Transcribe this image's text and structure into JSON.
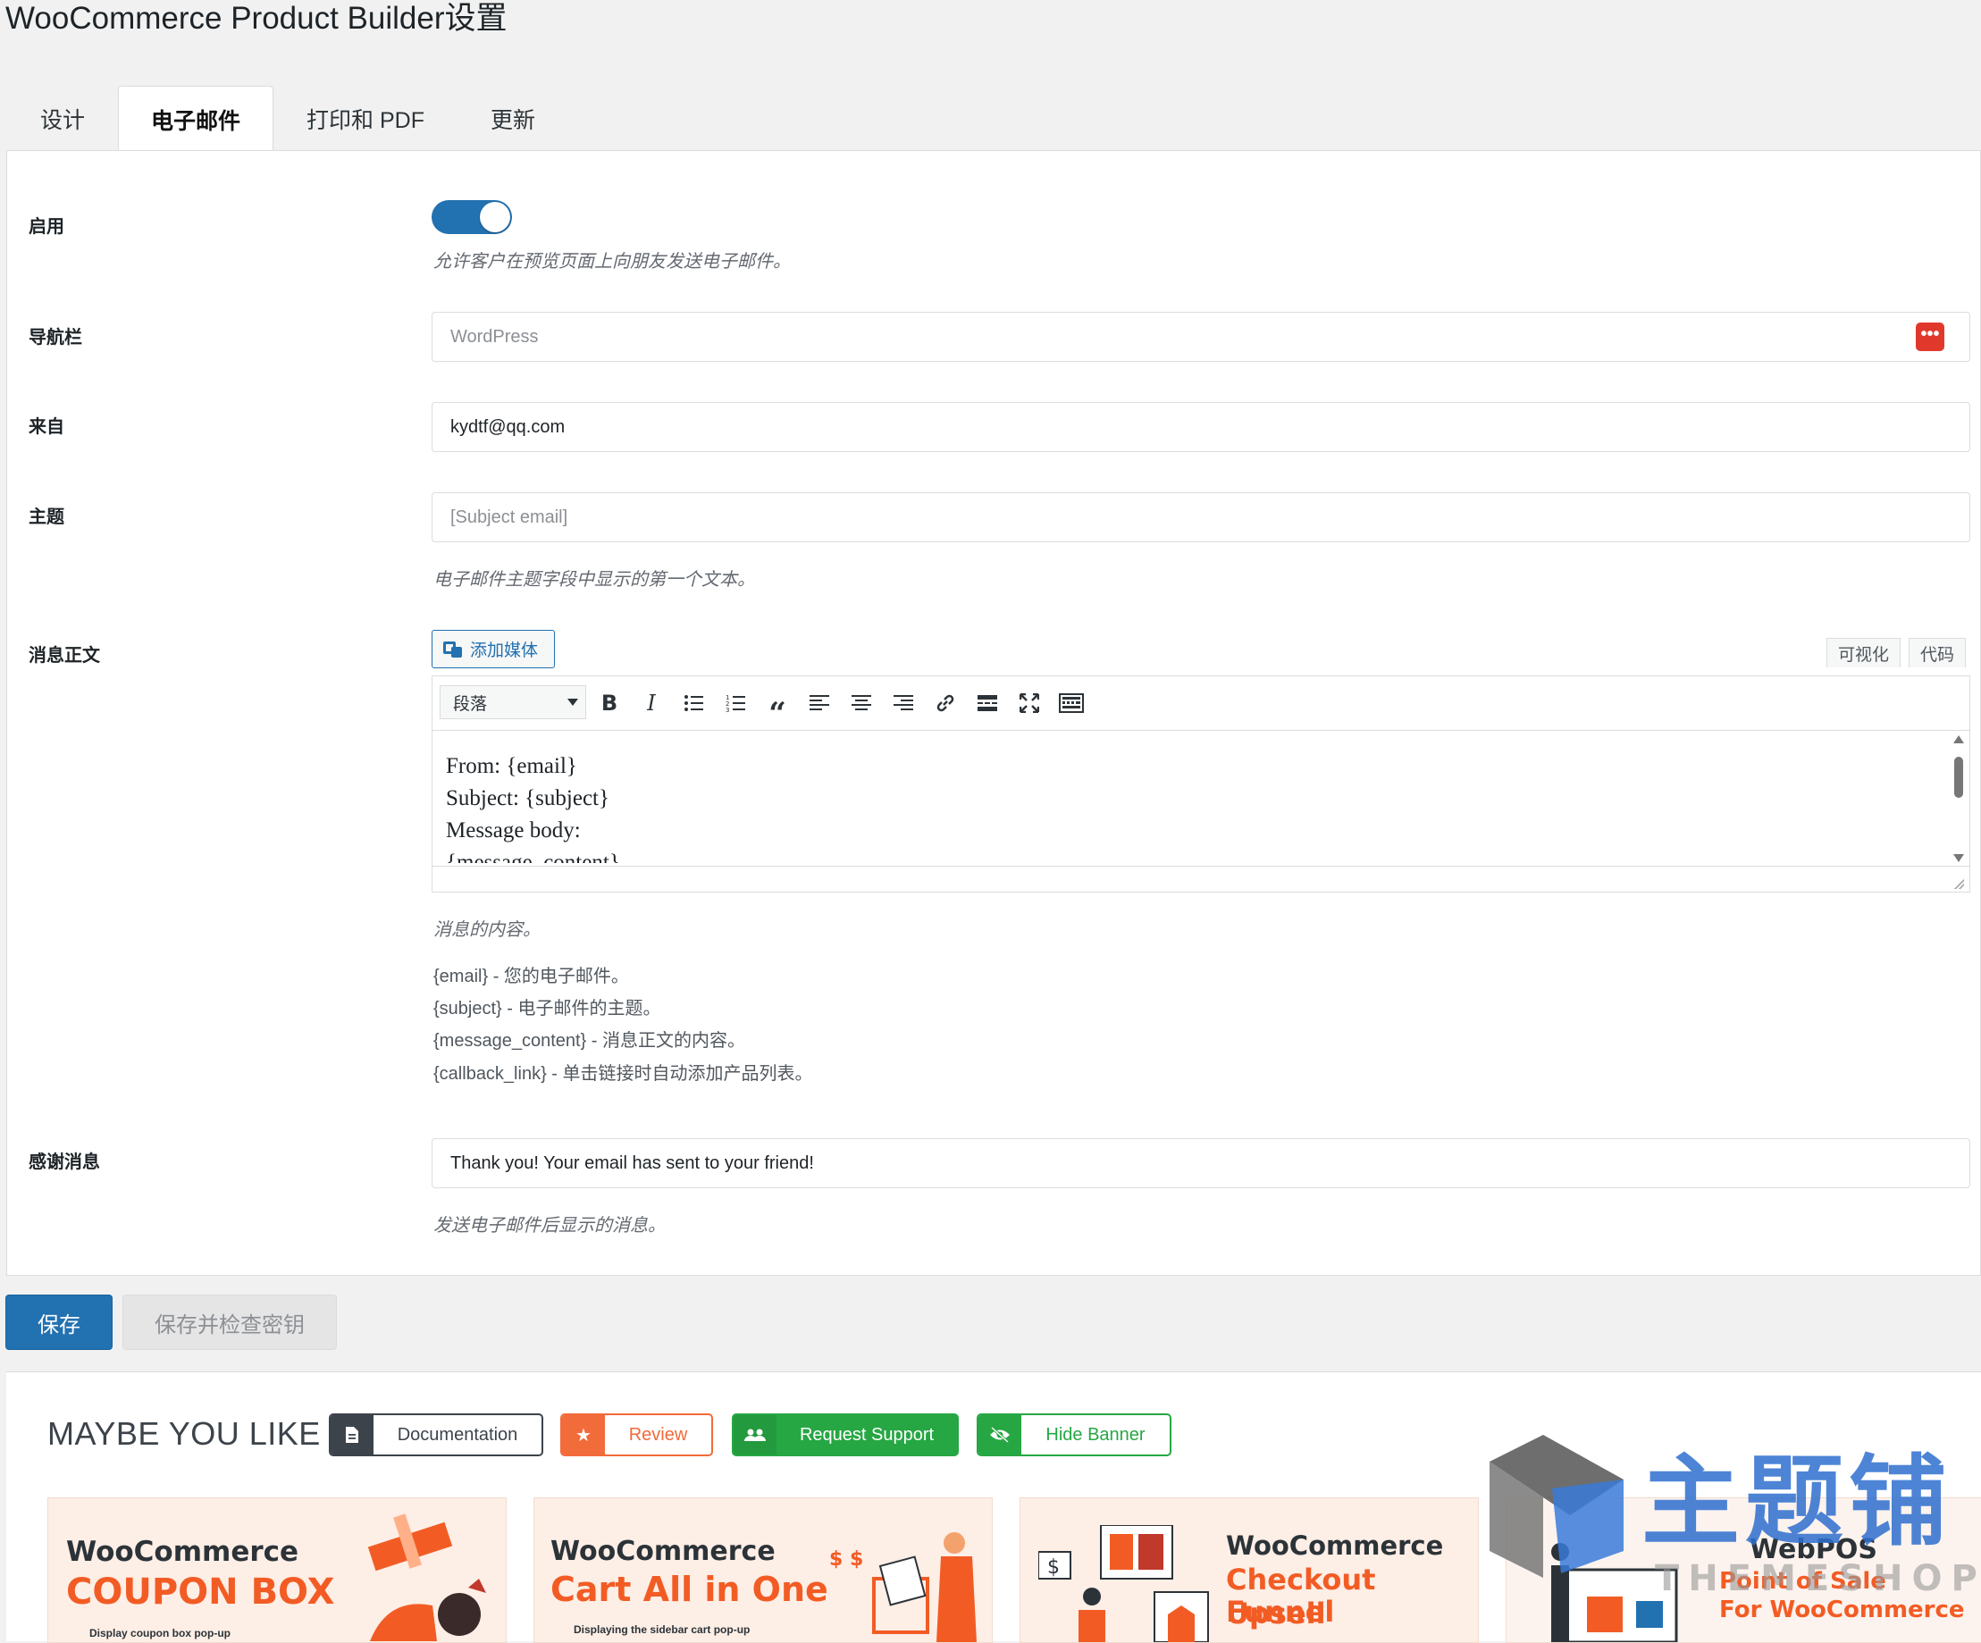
{
  "page_title": "WooCommerce Product Builder设置",
  "tabs": [
    {
      "label": "设计",
      "active": false
    },
    {
      "label": "电子邮件",
      "active": true
    },
    {
      "label": "打印和 PDF",
      "active": false
    },
    {
      "label": "更新",
      "active": false
    }
  ],
  "settings": {
    "enable": {
      "label": "启用",
      "on": true,
      "description": "允许客户在预览页面上向朋友发送电子邮件。"
    },
    "navbar": {
      "label": "导航栏",
      "placeholder": "WordPress",
      "more_icon": "more-dots-icon"
    },
    "from": {
      "label": "来自",
      "value": "kydtf@qq.com"
    },
    "subject": {
      "label": "主题",
      "placeholder": "[Subject email]",
      "description": "电子邮件主题字段中显示的第一个文本。"
    },
    "message_body": {
      "label": "消息正文",
      "add_media": "添加媒体",
      "visual_tab": "可视化",
      "code_tab": "代码",
      "format_select": "段落",
      "toolbar_icons": [
        "bold-icon",
        "italic-icon",
        "bullet-list-icon",
        "numbered-list-icon",
        "blockquote-icon",
        "align-left-icon",
        "align-center-icon",
        "align-right-icon",
        "link-icon",
        "read-more-icon",
        "fullscreen-icon",
        "toolbar-toggle-icon"
      ],
      "content_lines": [
        "From: {email}",
        "Subject: {subject}",
        "Message body:",
        "{message_content}"
      ],
      "description": "消息的内容。",
      "variables": [
        "{email} - 您的电子邮件。",
        "{subject} - 电子邮件的主题。",
        "{message_content} - 消息正文的内容。",
        "{callback_link} - 单击链接时自动添加产品列表。"
      ]
    },
    "thanks": {
      "label": "感谢消息",
      "value": "Thank you! Your email has sent to your friend!",
      "description": "发送电子邮件后显示的消息。"
    }
  },
  "buttons": {
    "save": "保存",
    "save_check": "保存并检查密钥"
  },
  "banner": {
    "title": "MAYBE YOU LIKE",
    "buttons": [
      {
        "label": "Documentation",
        "icon": "document-icon",
        "color": "#3c434a"
      },
      {
        "label": "Review",
        "icon": "star-icon",
        "color": "#f26b3a"
      },
      {
        "label": "Request Support",
        "icon": "users-icon",
        "color": "#27a744"
      },
      {
        "label": "Hide Banner",
        "icon": "hide-eye-icon",
        "color": "#27a744"
      }
    ],
    "cards": [
      {
        "line1": "WooCommerce",
        "line2": "COUPON BOX",
        "line3": "Display coupon box pop-up"
      },
      {
        "line1": "WooCommerce",
        "line2": "Cart All in One",
        "line3": "Displaying the sidebar cart pop-up"
      },
      {
        "line1": "WooCommerce",
        "line2": "Checkout Upsell",
        "line3": "Funnel"
      },
      {
        "line1": "WebPOS",
        "line2": "Point of Sale",
        "line3": "For WooCommerce"
      }
    ]
  },
  "watermark": {
    "text_cn": "主题铺",
    "text_en": "THEMESHOP"
  },
  "colors": {
    "primary": "#2271b1",
    "accent_orange": "#f25c24",
    "green": "#27a744",
    "danger": "#e0392b"
  }
}
